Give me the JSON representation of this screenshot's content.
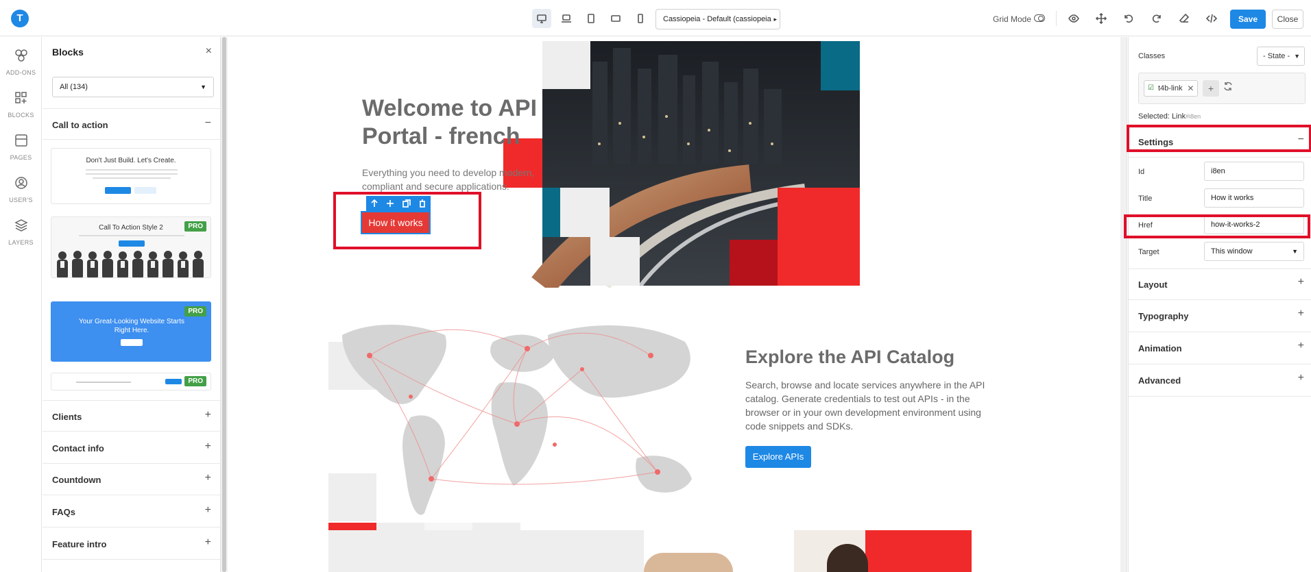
{
  "logo": "T",
  "topbar": {
    "devices": [
      "desktop-icon",
      "laptop-icon",
      "tablet-icon",
      "tablet-landscape-icon",
      "mobile-icon"
    ],
    "template_select": "Cassiopeia - Default (cassiopeia",
    "grid_mode_label": "Grid Mode",
    "save_label": "Save",
    "close_label": "Close"
  },
  "rail": {
    "items": [
      {
        "label": "ADD-ONS",
        "icon": "addons-icon"
      },
      {
        "label": "BLOCKS",
        "icon": "blocks-icon"
      },
      {
        "label": "PAGES",
        "icon": "pages-icon"
      },
      {
        "label": "USER'S",
        "icon": "user-icon"
      },
      {
        "label": "LAYERS",
        "icon": "layers-icon"
      }
    ]
  },
  "blocks": {
    "title": "Blocks",
    "close_glyph": "×",
    "filter": "All (134)",
    "categories": [
      {
        "label": "Call to action",
        "sign": "−"
      },
      {
        "label": "Clients",
        "sign": "+"
      },
      {
        "label": "Contact info",
        "sign": "+"
      },
      {
        "label": "Countdown",
        "sign": "+"
      },
      {
        "label": "FAQs",
        "sign": "+"
      },
      {
        "label": "Feature intro",
        "sign": "+"
      }
    ],
    "thumbs": [
      {
        "title": "Don't Just Build. Let's Create.",
        "pro": ""
      },
      {
        "title": "Call To Action Style 2",
        "pro": "PRO"
      },
      {
        "title": "Your Great-Looking Website Starts Right Here.",
        "pro": "PRO"
      },
      {
        "title": "",
        "pro": "PRO"
      }
    ]
  },
  "canvas": {
    "hero_title": "Welcome to API Portal - french",
    "hero_text": "Everything you need to develop modern, compliant and secure applications.",
    "hero_button": "How it works",
    "section2_title": "Explore the API Catalog",
    "section2_text": "Search, browse and locate services anywhere in the API catalog. Generate credentials to test out APIs - in the browser or in your own development environment using code snippets and SDKs.",
    "section2_button": "Explore APIs",
    "colors": {
      "red": "#f02a2a",
      "teal": "#0a6b86",
      "light": "#eeeeee",
      "darkred": "#b5121b",
      "blue": "#1e88e5"
    }
  },
  "rpanel": {
    "classes_label": "Classes",
    "state_select": "- State -",
    "class_tag": "t4b-link",
    "selected_label": "Selected:",
    "selected_type": "Link",
    "selected_id": "#i8en",
    "settings_label": "Settings",
    "settings_sign": "−",
    "props": [
      {
        "label": "Id",
        "value": "i8en"
      },
      {
        "label": "Title",
        "value": "How it works"
      },
      {
        "label": "Href",
        "value": "how-it-works-2"
      },
      {
        "label": "Target",
        "value": "This window"
      }
    ],
    "sections": [
      {
        "label": "Layout",
        "sign": "+"
      },
      {
        "label": "Typography",
        "sign": "+"
      },
      {
        "label": "Animation",
        "sign": "+"
      },
      {
        "label": "Advanced",
        "sign": "+"
      }
    ]
  }
}
